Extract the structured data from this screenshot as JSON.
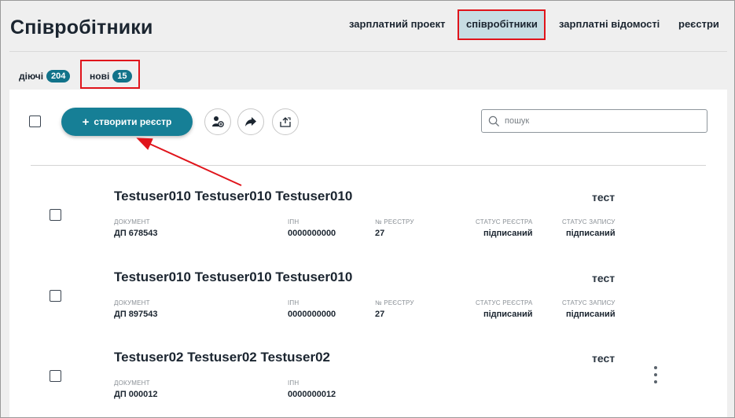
{
  "header": {
    "title": "Співробітники",
    "nav": [
      {
        "id": "salary_project",
        "label": "зарплатний проект"
      },
      {
        "id": "employees",
        "label": "співробітники",
        "active": true
      },
      {
        "id": "payrolls",
        "label": "зарплатні відомості"
      },
      {
        "id": "registers",
        "label": "реєстри"
      }
    ]
  },
  "filters": {
    "active": {
      "label": "діючі",
      "count": "204"
    },
    "new": {
      "label": "нові",
      "count": "15"
    }
  },
  "toolbar": {
    "create_label": "створити реєстр",
    "search_placeholder": "пошук"
  },
  "labels": {
    "document": "ДОКУМЕНТ",
    "inn": "ІПН",
    "register_no": "№ РЕЄСТРУ",
    "register_status": "СТАТУС РЕЄСТРА",
    "entry_status": "СТАТУС ЗАПИСУ"
  },
  "rows": [
    {
      "name": "Testuser010 Testuser010 Testuser010",
      "tag": "тест",
      "document": "ДП 678543",
      "inn": "0000000000",
      "register_no": "27",
      "register_status": "підписаний",
      "entry_status": "підписаний"
    },
    {
      "name": "Testuser010 Testuser010 Testuser010",
      "tag": "тест",
      "document": "ДП 897543",
      "inn": "0000000000",
      "register_no": "27",
      "register_status": "підписаний",
      "entry_status": "підписаний"
    },
    {
      "name": "Testuser02 Testuser02 Testuser02",
      "tag": "тест",
      "document": "ДП 000012",
      "inn": "0000000012"
    }
  ],
  "colors": {
    "accent": "#167f96",
    "badge": "#12738a",
    "highlight": "#e0141b",
    "active_tab_bg": "#c7dde3"
  }
}
